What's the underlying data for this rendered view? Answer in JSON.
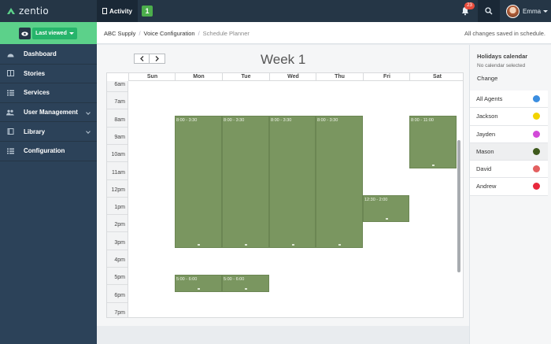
{
  "topbar": {
    "logo": "zentio",
    "activity_label": "Activity",
    "activity_badge": "1",
    "notification_count": "23",
    "user_name": "Emma"
  },
  "sidebar": {
    "last_viewed": "Last viewed",
    "items": [
      {
        "label": "Dashboard",
        "icon": "dashboard-icon"
      },
      {
        "label": "Stories",
        "icon": "book-icon"
      },
      {
        "label": "Services",
        "icon": "list-icon"
      },
      {
        "label": "User Management",
        "icon": "users-icon"
      },
      {
        "label": "Library",
        "icon": "library-icon"
      },
      {
        "label": "Configuration",
        "icon": "list-icon"
      }
    ]
  },
  "breadcrumb": [
    "ABC Supply",
    "Voice Configuration",
    "Schedule Planner"
  ],
  "save_status": "All changes saved in schedule.",
  "calendar": {
    "title": "Week 1",
    "days": [
      "Sun",
      "Mon",
      "Tue",
      "Wed",
      "Thu",
      "Fri",
      "Sat"
    ],
    "times": [
      "6am",
      "7am",
      "8am",
      "9am",
      "10am",
      "11am",
      "12pm",
      "1pm",
      "2pm",
      "3pm",
      "4pm",
      "5pm",
      "6pm",
      "7pm"
    ],
    "events": [
      {
        "label": "8:00 - 3:30"
      },
      {
        "label": "8:00 - 3:30"
      },
      {
        "label": "8:00 - 3:30"
      },
      {
        "label": "8:00 - 3:30"
      },
      {
        "label": "12:30 - 2:00"
      },
      {
        "label": "8:00 - 11:00"
      },
      {
        "label": "5:00 - 6:00"
      },
      {
        "label": "5:00 - 6:00"
      }
    ]
  },
  "holidays": {
    "title": "Holidays calendar",
    "subtitle": "No calendar selected",
    "change_label": "Change"
  },
  "agents": [
    {
      "name": "All Agents",
      "color": "#3b8ee0"
    },
    {
      "name": "Jackson",
      "color": "#f2d300"
    },
    {
      "name": "Jayden",
      "color": "#d24ad8"
    },
    {
      "name": "Mason",
      "color": "#3f5a1c"
    },
    {
      "name": "David",
      "color": "#e36060"
    },
    {
      "name": "Andrew",
      "color": "#e8283c"
    }
  ],
  "colors": {
    "topbar": "#253646",
    "sidebar": "#2c4259",
    "accent_green": "#5cd18a",
    "event_green": "#7a9660"
  }
}
